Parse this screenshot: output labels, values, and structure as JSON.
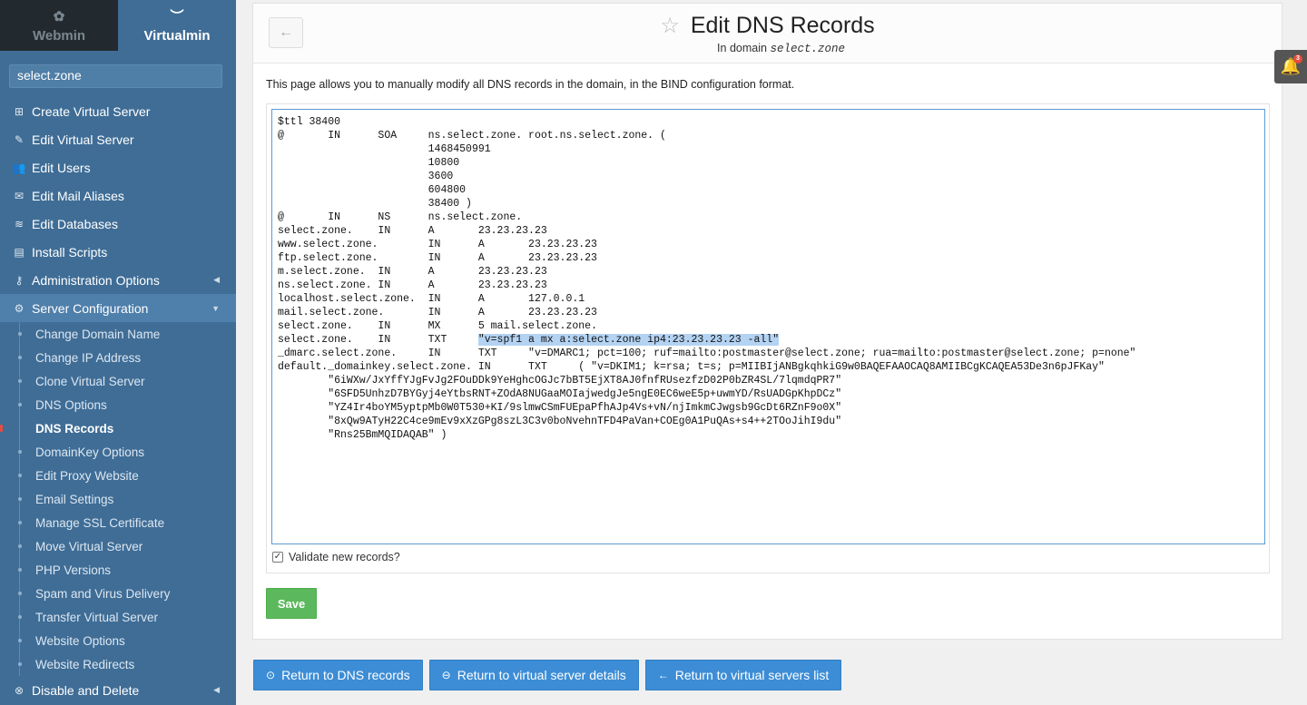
{
  "tabs": {
    "webmin": "Webmin",
    "virtualmin": "Virtualmin"
  },
  "domain": "select.zone",
  "menu": [
    {
      "label": "Create Virtual Server",
      "icon": "plus-square-icon"
    },
    {
      "label": "Edit Virtual Server",
      "icon": "edit-icon"
    },
    {
      "label": "Edit Users",
      "icon": "users-icon"
    },
    {
      "label": "Edit Mail Aliases",
      "icon": "envelope-icon"
    },
    {
      "label": "Edit Databases",
      "icon": "database-icon"
    },
    {
      "label": "Install Scripts",
      "icon": "scripts-icon"
    },
    {
      "label": "Administration Options",
      "icon": "key-icon"
    },
    {
      "label": "Server Configuration",
      "icon": "cogs-icon"
    }
  ],
  "submenu": [
    "Change Domain Name",
    "Change IP Address",
    "Clone Virtual Server",
    "DNS Options",
    "DNS Records",
    "DomainKey Options",
    "Edit Proxy Website",
    "Email Settings",
    "Manage SSL Certificate",
    "Move Virtual Server",
    "PHP Versions",
    "Spam and Virus Delivery",
    "Transfer Virtual Server",
    "Website Options",
    "Website Redirects"
  ],
  "menu_bottom": {
    "label": "Disable and Delete",
    "icon": "disable-icon"
  },
  "page": {
    "title": "Edit DNS Records",
    "subtitle_prefix": "In domain",
    "subtitle_domain": "select.zone",
    "description": "This page allows you to manually modify all DNS records in the domain, in the BIND configuration format.",
    "validate_label": "Validate new records?",
    "save_label": "Save"
  },
  "zone": {
    "before": "$ttl 38400\n@\tIN\tSOA\tns.select.zone. root.ns.select.zone. (\n\t\t\t1468450991\n\t\t\t10800\n\t\t\t3600\n\t\t\t604800\n\t\t\t38400 )\n@\tIN\tNS\tns.select.zone.\nselect.zone.\tIN\tA\t23.23.23.23\nwww.select.zone.\tIN\tA\t23.23.23.23\nftp.select.zone.\tIN\tA\t23.23.23.23\nm.select.zone.\tIN\tA\t23.23.23.23\nns.select.zone.\tIN\tA\t23.23.23.23\nlocalhost.select.zone.\tIN\tA\t127.0.0.1\nmail.select.zone.\tIN\tA\t23.23.23.23\nselect.zone.\tIN\tMX\t5 mail.select.zone.\nselect.zone.\tIN\tTXT\t",
    "highlight": "\"v=spf1 a mx a:select.zone ip4:23.23.23.23 -all\"",
    "after": "\n_dmarc.select.zone.\tIN\tTXT\t\"v=DMARC1; pct=100; ruf=mailto:postmaster@select.zone; rua=mailto:postmaster@select.zone; p=none\"\ndefault._domainkey.select.zone.\tIN\tTXT\t( \"v=DKIM1; k=rsa; t=s; p=MIIBIjANBgkqhkiG9w0BAQEFAAOCAQ8AMIIBCgKCAQEA53De3n6pJFKay\"\n\t\"6iWXw/JxYffYJgFvJg2FOuDDk9YeHghcOGJc7bBT5EjXT8AJ0fnfRUsezfzD02P0bZR4SL/7lqmdqPR7\"\n\t\"6SFD5UnhzD7BYGyj4eYtbsRNT+ZOdA8NUGaaMOIajwedgJe5ngE0EC6weE5p+uwmYD/RsUADGpKhpDCz\"\n\t\"YZ4Ir4boYM5yptpMb0W0T530+KI/9slmwCSmFUEpaPfhAJp4Vs+vN/njImkmCJwgsb9GcDt6RZnF9o0X\"\n\t\"8xQw9ATyH22C4ce9mEv9xXzGPg8szL3C3v0boNvehnTFD4PaVan+COEg0A1PuQAs+s4++2TOoJihI9du\"\n\t\"Rns25BmMQIDAQAB\" )"
  },
  "bottom_buttons": [
    {
      "label": "Return to DNS records",
      "icon": "arrow-circle-icon"
    },
    {
      "label": "Return to virtual server details",
      "icon": "arrow-left-circle-icon"
    },
    {
      "label": "Return to virtual servers list",
      "icon": "arrow-left-icon"
    }
  ],
  "notifications": {
    "count": "3"
  }
}
